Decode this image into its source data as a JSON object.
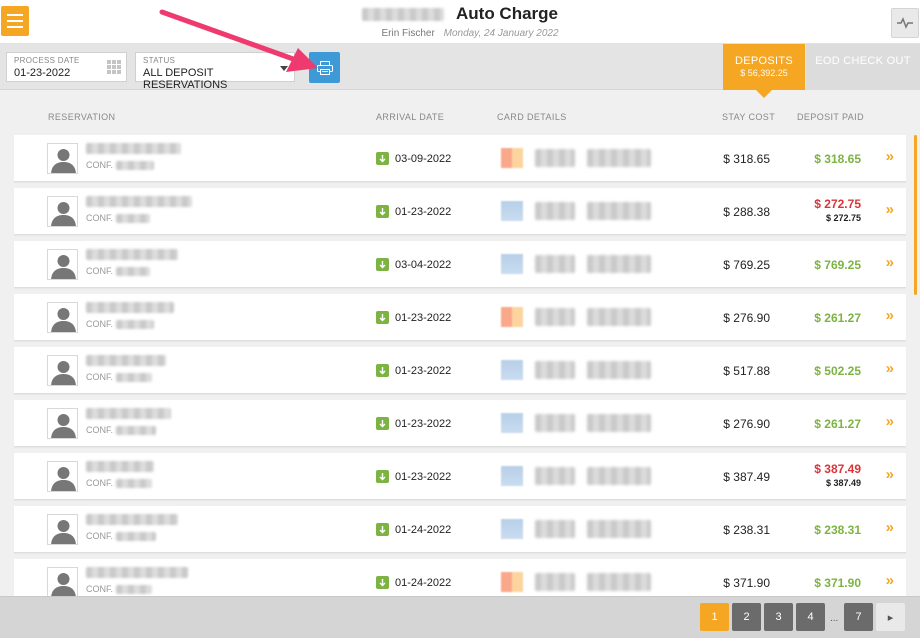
{
  "header": {
    "title": "Auto Charge",
    "user": "Erin Fischer",
    "date": "Monday, 24 January 2022"
  },
  "icons": {
    "menu": "hamburger-icon",
    "activity": "activity-icon",
    "print": "printer-icon",
    "calendar": "calendar-icon",
    "arrival": "arrow-down-icon",
    "row_action": "double-chevron-right-icon"
  },
  "toolbar": {
    "process_date_label": "PROCESS DATE",
    "process_date_value": "01-23-2022",
    "status_label": "STATUS",
    "status_value": "ALL DEPOSIT RESERVATIONS"
  },
  "tabs": {
    "deposits_label": "DEPOSITS",
    "deposits_amount": "$ 56,392.25",
    "eod_label": "EOD CHECK OUT"
  },
  "columns": {
    "reservation": "RESERVATION",
    "arrival": "ARRIVAL DATE",
    "card": "CARD DETAILS",
    "stay": "STAY COST",
    "paid": "DEPOSIT PAID"
  },
  "conf_prefix": "CONF.",
  "rows": [
    {
      "arrival": "03-09-2022",
      "stay": "$ 318.65",
      "paid": "$ 318.65",
      "paid_status": "green",
      "paid_sub": ""
    },
    {
      "arrival": "01-23-2022",
      "stay": "$ 288.38",
      "paid": "$ 272.75",
      "paid_status": "red",
      "paid_sub": "$ 272.75"
    },
    {
      "arrival": "03-04-2022",
      "stay": "$ 769.25",
      "paid": "$ 769.25",
      "paid_status": "green",
      "paid_sub": ""
    },
    {
      "arrival": "01-23-2022",
      "stay": "$ 276.90",
      "paid": "$ 261.27",
      "paid_status": "green",
      "paid_sub": ""
    },
    {
      "arrival": "01-23-2022",
      "stay": "$ 517.88",
      "paid": "$ 502.25",
      "paid_status": "green",
      "paid_sub": ""
    },
    {
      "arrival": "01-23-2022",
      "stay": "$ 276.90",
      "paid": "$ 261.27",
      "paid_status": "green",
      "paid_sub": ""
    },
    {
      "arrival": "01-23-2022",
      "stay": "$ 387.49",
      "paid": "$ 387.49",
      "paid_status": "red",
      "paid_sub": "$ 387.49"
    },
    {
      "arrival": "01-24-2022",
      "stay": "$ 238.31",
      "paid": "$ 238.31",
      "paid_status": "green",
      "paid_sub": ""
    },
    {
      "arrival": "01-24-2022",
      "stay": "$ 371.90",
      "paid": "$ 371.90",
      "paid_status": "green",
      "paid_sub": ""
    }
  ],
  "pagination": {
    "pages": [
      "1",
      "2",
      "3",
      "4"
    ],
    "ellipsis": "...",
    "last": "7",
    "next": "▸",
    "current": "1"
  },
  "colors": {
    "accent": "#f5a623",
    "positive": "#7cb342",
    "negative": "#d9343a",
    "print_button": "#3d9ad6",
    "annotation_arrow": "#ee3a6e"
  }
}
